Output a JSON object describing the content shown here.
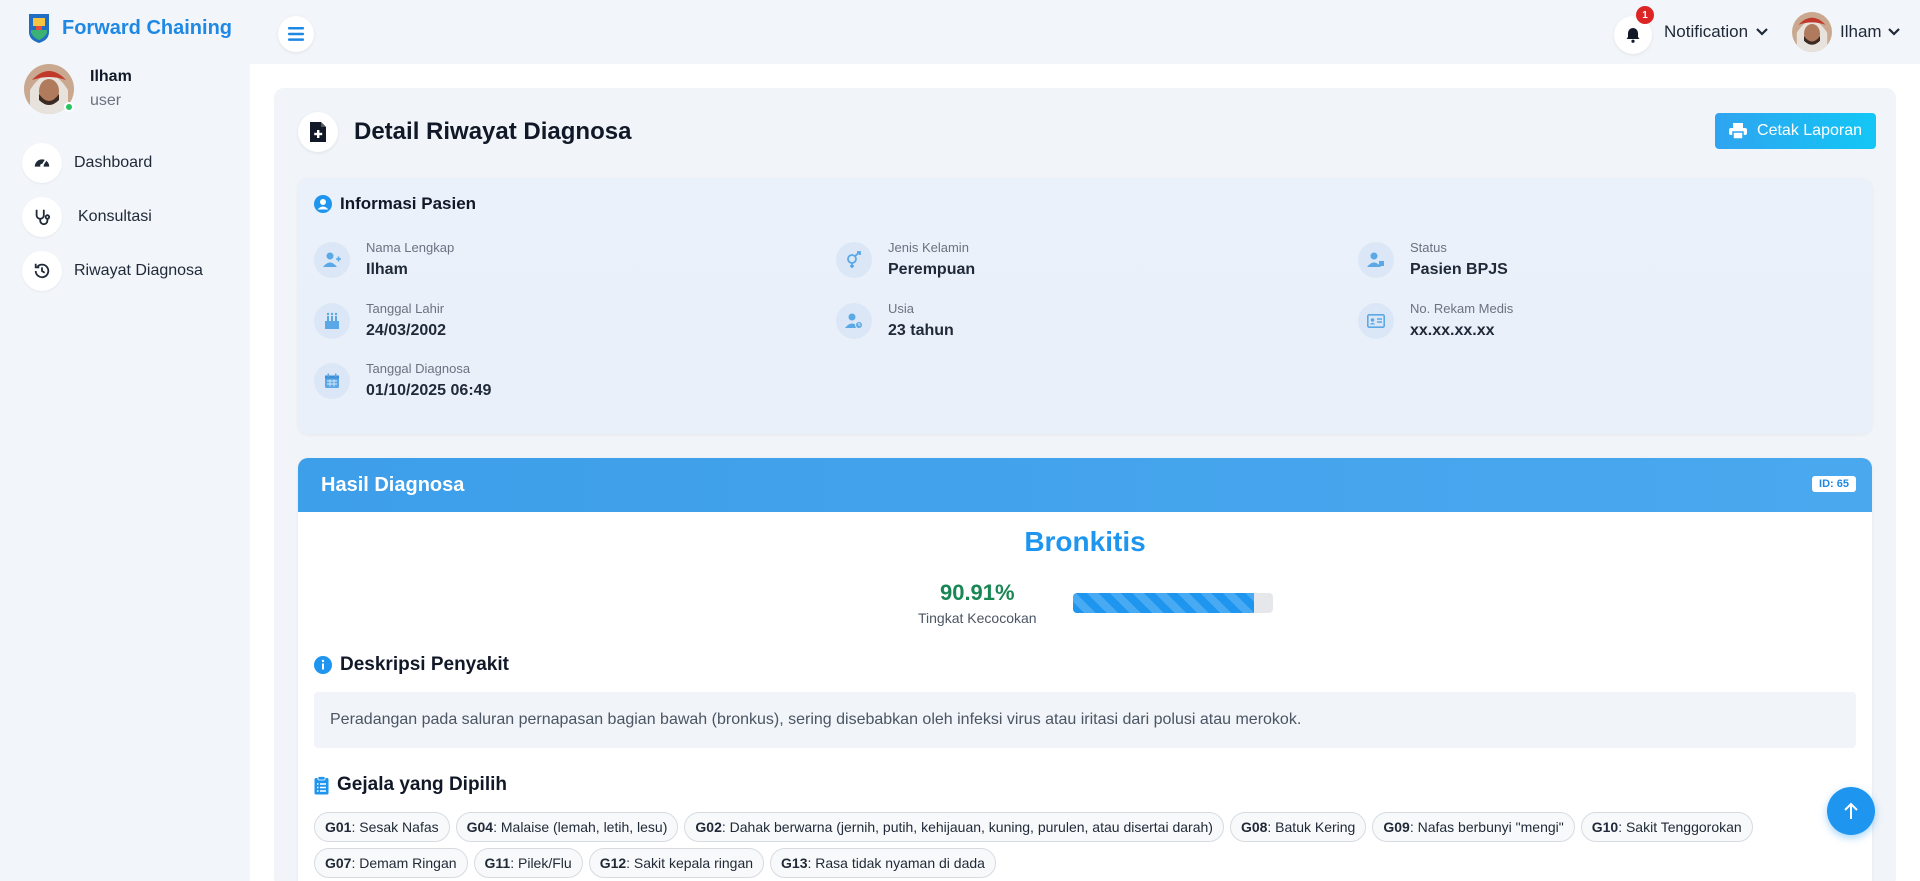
{
  "brand": {
    "name": "Forward Chaining"
  },
  "sidebar": {
    "user": {
      "name": "Ilham",
      "role": "user"
    },
    "items": [
      {
        "label": "Dashboard",
        "icon": "gauge-icon"
      },
      {
        "label": "Konsultasi",
        "icon": "stethoscope-icon"
      },
      {
        "label": "Riwayat Diagnosa",
        "icon": "history-icon"
      }
    ]
  },
  "header": {
    "notification_label": "Notification",
    "notification_count": "1",
    "user_name": "Ilham"
  },
  "page": {
    "title": "Detail Riwayat Diagnosa",
    "print_label": "Cetak Laporan"
  },
  "patient": {
    "section_title": "Informasi Pasien",
    "fields": [
      {
        "label": "Nama Lengkap",
        "value": "Ilham",
        "icon": "user-icon"
      },
      {
        "label": "Jenis Kelamin",
        "value": "Perempuan",
        "icon": "gender-icon"
      },
      {
        "label": "Status",
        "value": "Pasien BPJS",
        "icon": "user-tag-icon"
      },
      {
        "label": "Tanggal Lahir",
        "value": "24/03/2002",
        "icon": "birthday-cake-icon"
      },
      {
        "label": "Usia",
        "value": "23 tahun",
        "icon": "user-clock-icon"
      },
      {
        "label": "No. Rekam Medis",
        "value": "xx.xx.xx.xx",
        "icon": "id-card-icon"
      },
      {
        "label": "Tanggal Diagnosa",
        "value": "01/10/2025 06:49",
        "icon": "calendar-icon"
      }
    ]
  },
  "result": {
    "header": "Hasil Diagnosa",
    "id_badge": "ID: 65",
    "disease": "Bronkitis",
    "match_percent": "90.91%",
    "match_value": 90.91,
    "match_label": "Tingkat Kecocokan",
    "description_title": "Deskripsi Penyakit",
    "description": "Peradangan pada saluran pernapasan bagian bawah (bronkus), sering disebabkan oleh infeksi virus atau iritasi dari polusi atau merokok.",
    "symptoms_title": "Gejala yang Dipilih",
    "symptoms": [
      {
        "code": "G01",
        "text": ": Sesak Nafas"
      },
      {
        "code": "G04",
        "text": ": Malaise (lemah, letih, lesu)"
      },
      {
        "code": "G02",
        "text": ": Dahak berwarna (jernih, putih, kehijauan, kuning, purulen, atau disertai darah)"
      },
      {
        "code": "G08",
        "text": ": Batuk Kering"
      },
      {
        "code": "G09",
        "text": ": Nafas berbunyi \"mengi\""
      },
      {
        "code": "G10",
        "text": ": Sakit Tenggorokan"
      },
      {
        "code": "G07",
        "text": ": Demam Ringan"
      },
      {
        "code": "G11",
        "text": ": Pilek/Flu"
      },
      {
        "code": "G12",
        "text": ": Sakit kepala ringan"
      },
      {
        "code": "G13",
        "text": ": Rasa tidak nyaman di dada"
      }
    ]
  },
  "colors": {
    "primary": "#1e96ef",
    "success": "#198754",
    "danger": "#dc2626"
  }
}
